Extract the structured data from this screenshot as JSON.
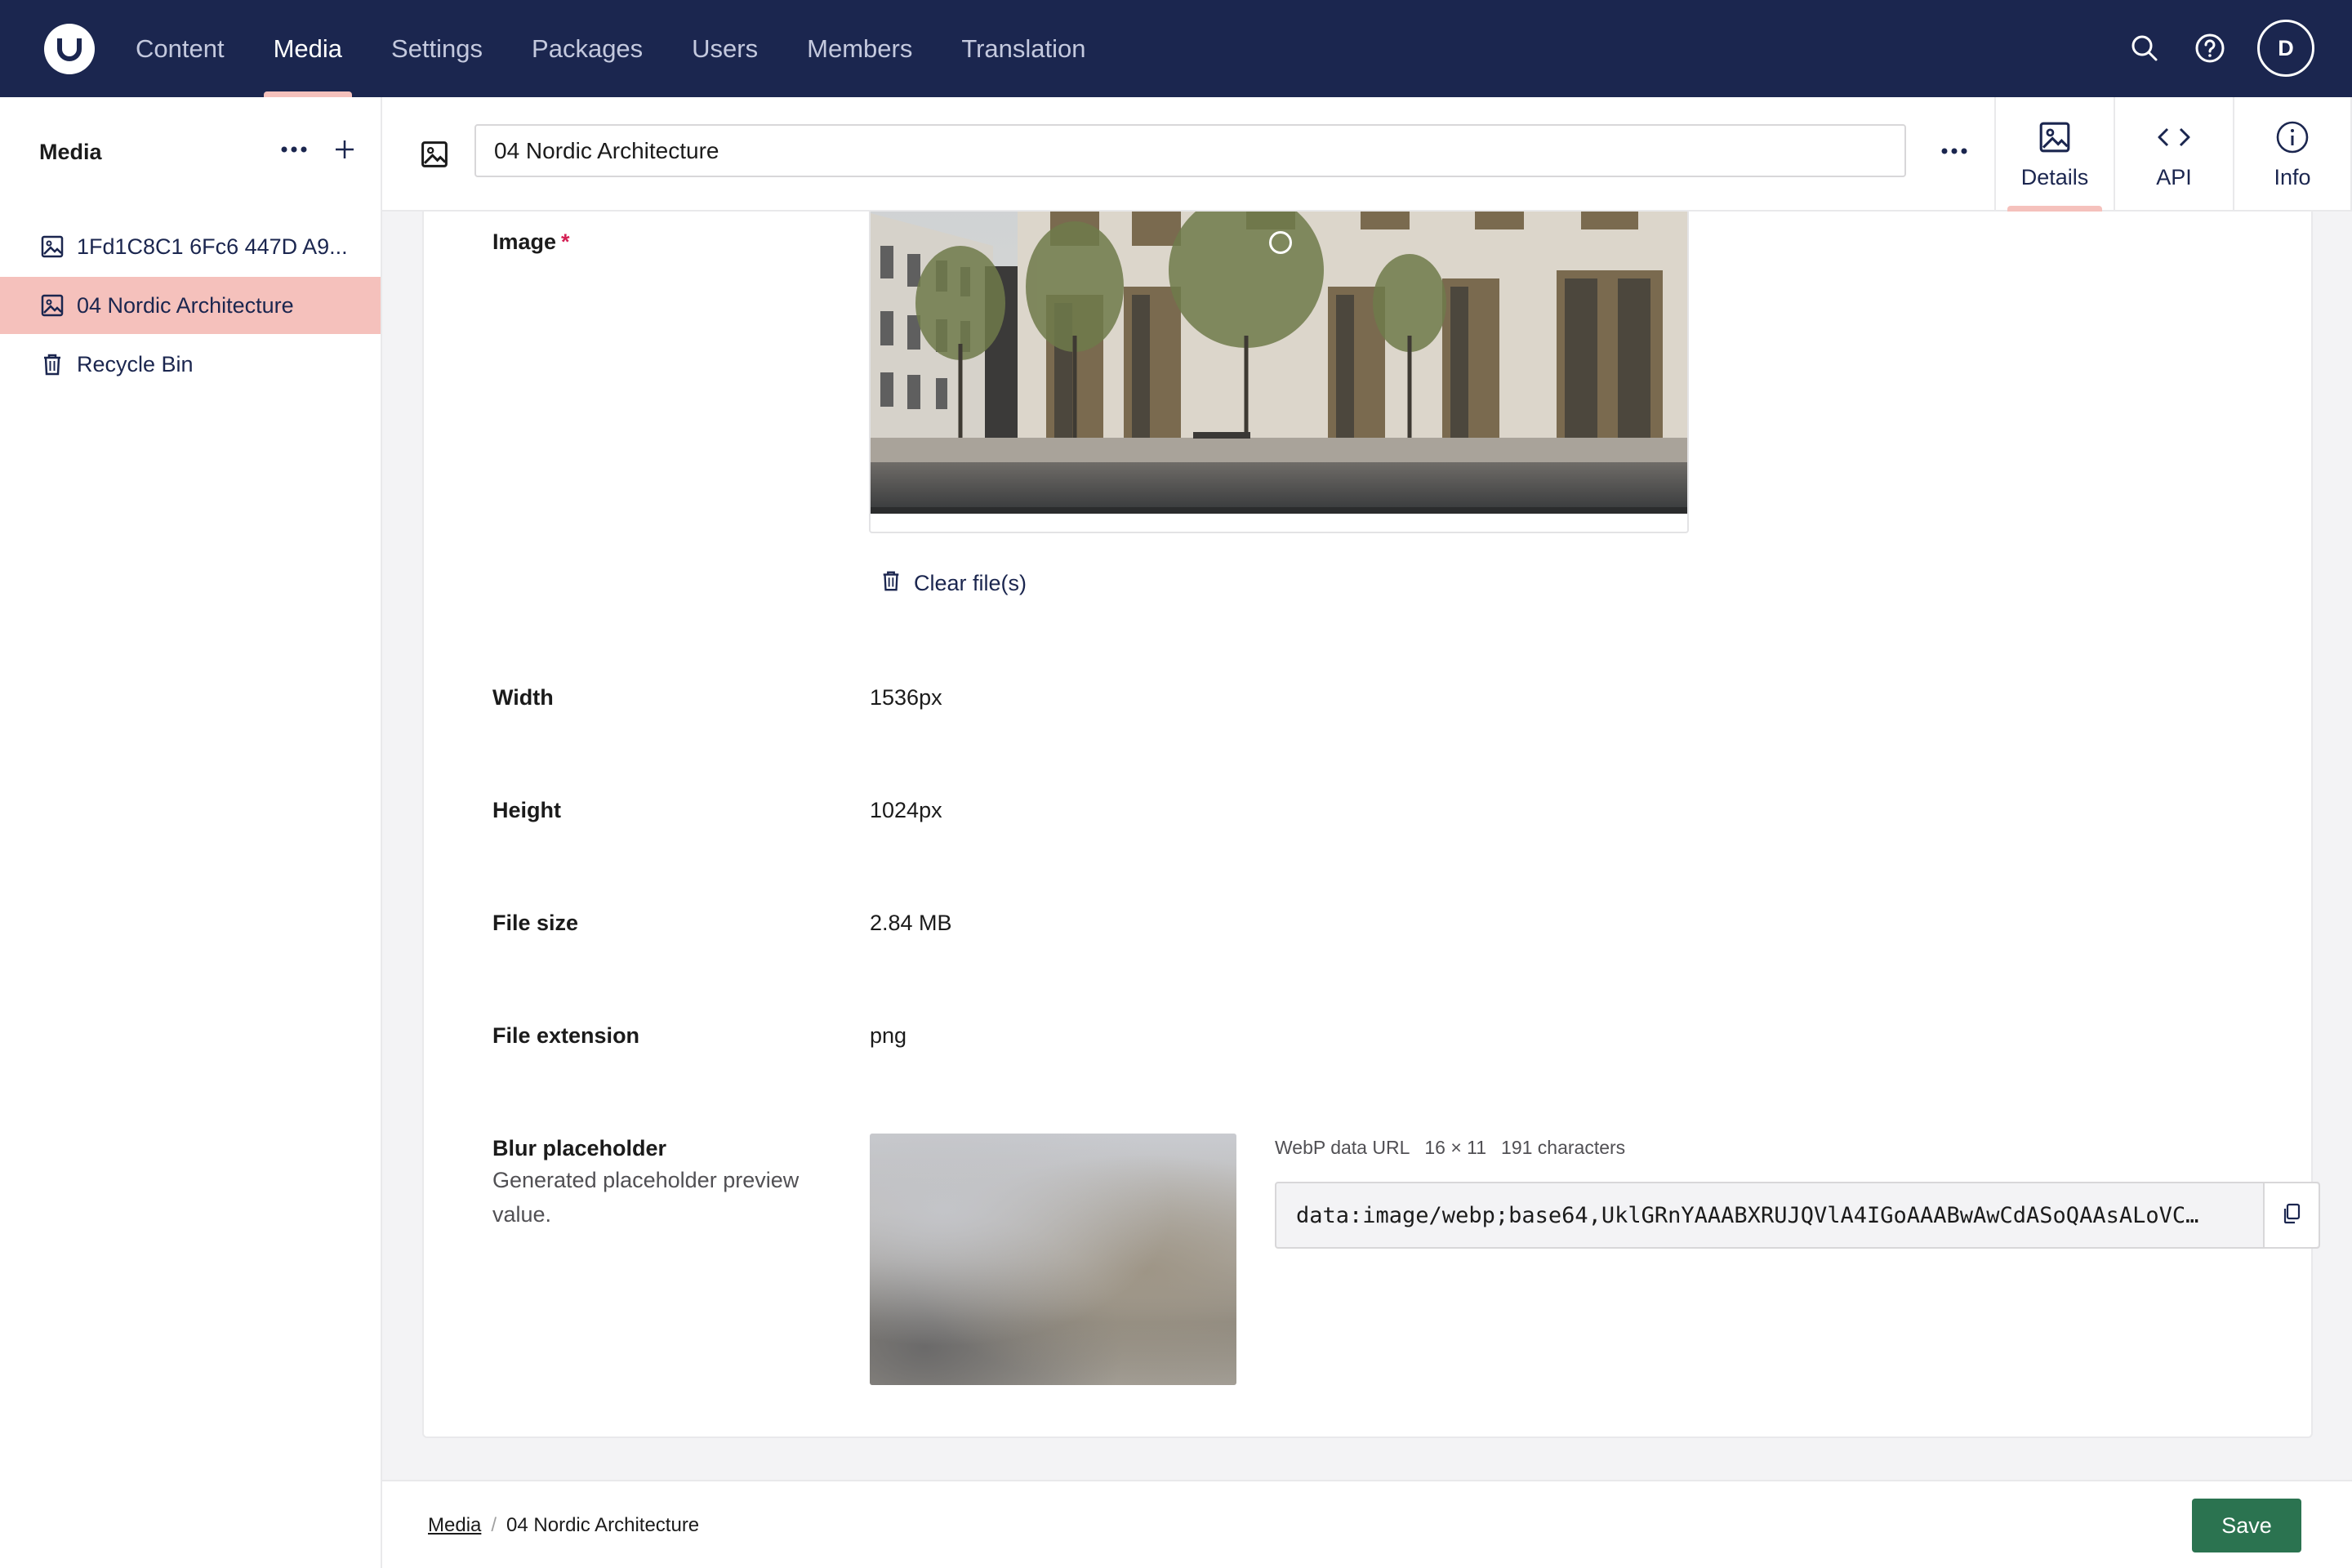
{
  "app": {
    "brand_colors": {
      "header_bg": "#1b264f",
      "accent": "#f5c1bc",
      "save": "#2b7350",
      "required": "#d42054"
    }
  },
  "header": {
    "nav": [
      {
        "label": "Content",
        "active": false
      },
      {
        "label": "Media",
        "active": true
      },
      {
        "label": "Settings",
        "active": false
      },
      {
        "label": "Packages",
        "active": false
      },
      {
        "label": "Users",
        "active": false
      },
      {
        "label": "Members",
        "active": false
      },
      {
        "label": "Translation",
        "active": false
      }
    ],
    "icons": [
      "search-icon",
      "help-icon"
    ],
    "avatar_initial": "D"
  },
  "sidebar": {
    "title": "Media",
    "items": [
      {
        "label": "1Fd1C8C1 6Fc6 447D A9...",
        "icon": "image-icon",
        "selected": false
      },
      {
        "label": "04 Nordic Architecture",
        "icon": "image-icon",
        "selected": true
      },
      {
        "label": "Recycle Bin",
        "icon": "trash-icon",
        "selected": false
      }
    ]
  },
  "workspace": {
    "name_value": "04 Nordic Architecture",
    "views": [
      {
        "label": "Details",
        "icon": "image-icon",
        "active": true
      },
      {
        "label": "API",
        "icon": "code-icon",
        "active": false
      },
      {
        "label": "Info",
        "icon": "info-icon",
        "active": false
      }
    ]
  },
  "properties": {
    "image": {
      "label": "Image",
      "required_mark": "*",
      "clear_label": "Clear file(s)"
    },
    "width": {
      "label": "Width",
      "value": "1536px"
    },
    "height": {
      "label": "Height",
      "value": "1024px"
    },
    "file_size": {
      "label": "File size",
      "value": "2.84 MB"
    },
    "file_extension": {
      "label": "File extension",
      "value": "png"
    },
    "blur_placeholder": {
      "label": "Blur placeholder",
      "description": "Generated placeholder preview value.",
      "format": "WebP data URL",
      "dimensions": "16 × 11",
      "length": "191 characters",
      "data_url": "data:image/webp;base64,UklGRnYAAABXRUJQVlA4IGoAAABwAwCdASoQAAsALoVC…"
    }
  },
  "footer": {
    "breadcrumb": [
      {
        "label": "Media",
        "link": true
      },
      {
        "label": "04 Nordic Architecture",
        "link": false
      }
    ],
    "save_label": "Save"
  }
}
